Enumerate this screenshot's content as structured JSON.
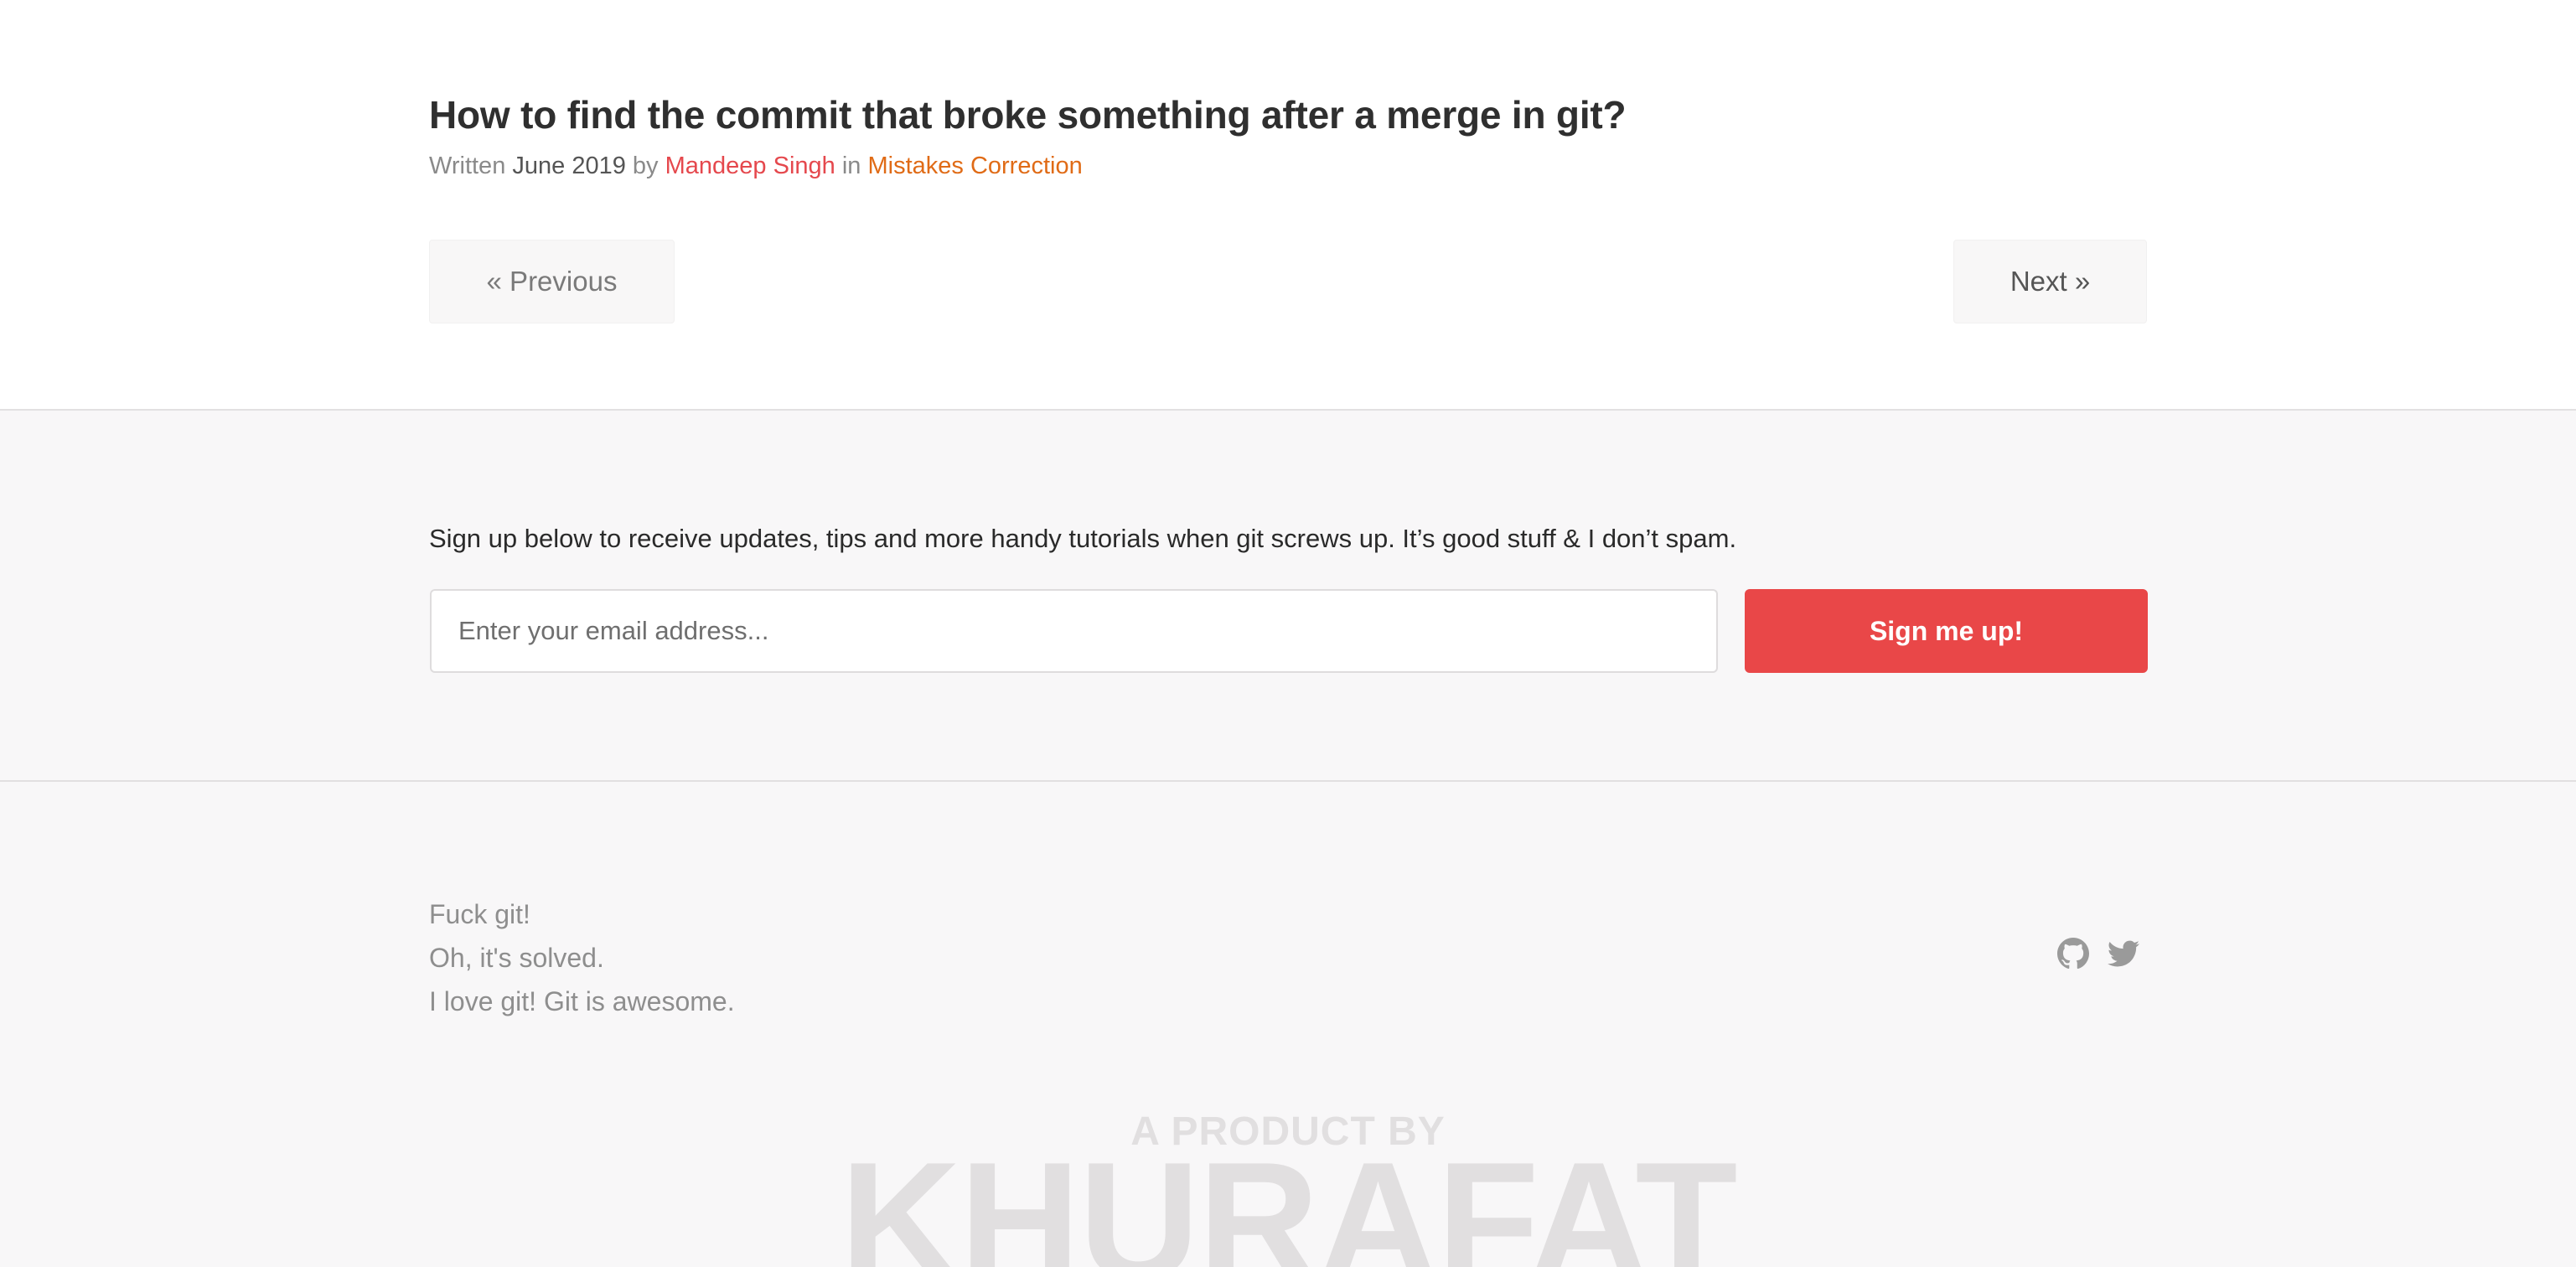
{
  "article": {
    "title": "How to find the commit that broke something after a merge in git?",
    "meta": {
      "written_label": "Written",
      "date": "June 2019",
      "by_label": "by",
      "author": "Mandeep Singh",
      "in_label": "in",
      "category": "Mistakes Correction"
    },
    "pager": {
      "previous_label": "« Previous",
      "next_label": "Next »"
    }
  },
  "signup": {
    "text": "Sign up below to receive updates, tips and more handy tutorials when git screws up. It’s good stuff & I don’t spam.",
    "email_placeholder": "Enter your email address...",
    "email_value": "",
    "button_label": "Sign me up!"
  },
  "footer": {
    "lines": [
      "Fuck git!",
      "Oh, it's solved.",
      "I love git! Git is awesome."
    ],
    "social_icons": [
      "github-icon",
      "twitter-icon"
    ],
    "product_by": "A PRODUCT BY",
    "brand": "KHURAFAT"
  },
  "colors": {
    "author": "#e5484d",
    "category": "#e06b16",
    "button": "#e94748",
    "section_bg": "#f8f7f8",
    "watermark": "#e1dfe0"
  }
}
